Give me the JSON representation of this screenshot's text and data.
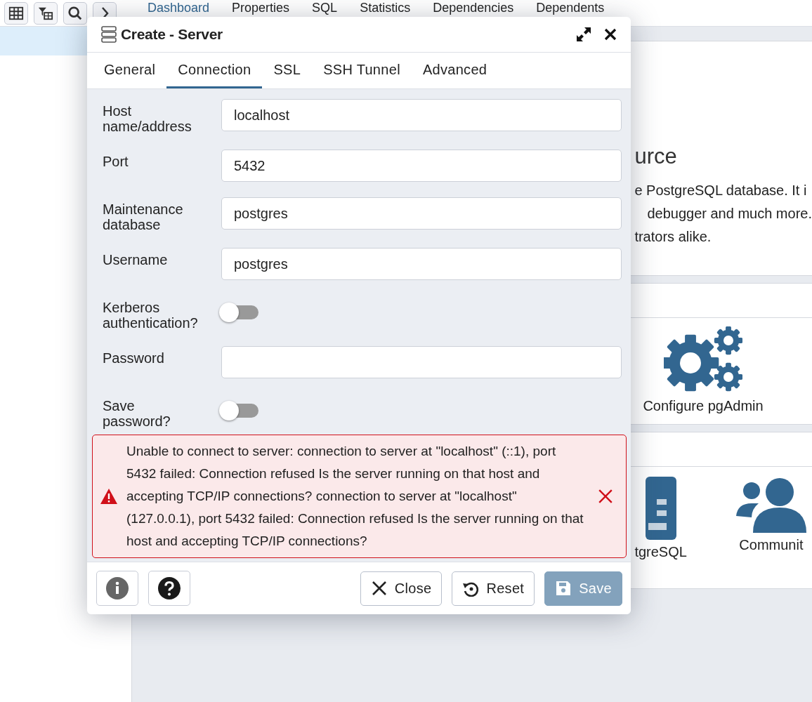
{
  "app": {
    "panel_tabs": [
      {
        "label": "Dashboard",
        "selected": true
      },
      {
        "label": "Properties",
        "selected": false
      },
      {
        "label": "SQL",
        "selected": false
      },
      {
        "label": "Statistics",
        "selected": false
      },
      {
        "label": "Dependencies",
        "selected": false
      },
      {
        "label": "Dependents",
        "selected": false
      }
    ],
    "welcome": {
      "heading": "urce",
      "lines": [
        "e PostgreSQL database. It i",
        "debugger and much more.",
        "trators alike."
      ]
    },
    "quick_links": [
      {
        "kind": "gears",
        "label": "Configure pgAdmin"
      }
    ],
    "community_links": [
      {
        "kind": "database",
        "label": "tgreSQL"
      },
      {
        "kind": "people",
        "label": "Communit"
      }
    ]
  },
  "dialog": {
    "title": "Create - Server",
    "tabs": [
      {
        "label": "General",
        "selected": false
      },
      {
        "label": "Connection",
        "selected": true
      },
      {
        "label": "SSL",
        "selected": false
      },
      {
        "label": "SSH Tunnel",
        "selected": false
      },
      {
        "label": "Advanced",
        "selected": false
      }
    ],
    "fields": [
      {
        "kind": "text",
        "label": "Host name/address",
        "value": "localhost"
      },
      {
        "kind": "text",
        "label": "Port",
        "value": "5432"
      },
      {
        "kind": "text",
        "label": "Maintenance database",
        "value": "postgres"
      },
      {
        "kind": "text",
        "label": "Username",
        "value": "postgres"
      },
      {
        "kind": "toggle",
        "label": "Kerberos authentication?",
        "on": false
      },
      {
        "kind": "password",
        "label": "Password"
      },
      {
        "kind": "toggle",
        "label": "Save password?",
        "on": false
      }
    ],
    "error": "Unable to connect to server: connection to server at \"localhost\" (::1), port 5432 failed: Connection refused Is the server running on that host and accepting TCP/IP connections? connection to server at \"localhost\" (127.0.0.1), port 5432 failed: Connection refused Is the server running on that host and accepting TCP/IP connections?",
    "buttons": [
      {
        "kind": "close",
        "label": "Close",
        "disabled": false
      },
      {
        "kind": "reset",
        "label": "Reset",
        "disabled": false
      },
      {
        "kind": "save",
        "label": "Save",
        "disabled": true
      }
    ]
  }
}
